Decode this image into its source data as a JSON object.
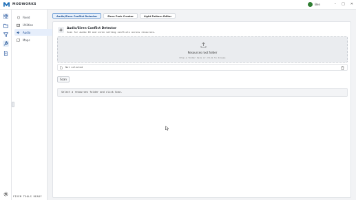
{
  "app": {
    "name": "MODWORKS",
    "logo_icon": "m-logo-icon"
  },
  "user": {
    "name": "Ben",
    "avatar_color": "#2e7d32"
  },
  "window_controls": [
    "–",
    "□",
    "✕"
  ],
  "rail": {
    "icons": [
      "grid-icon",
      "folder-icon",
      "funnel-icon",
      "wrench-icon",
      "document-icon"
    ],
    "active_index": 3,
    "settings_icon": "gear-icon"
  },
  "subnav": {
    "items": [
      {
        "label": "Fixed",
        "icon": "phone-icon"
      },
      {
        "label": "Utilities",
        "icon": "box-icon"
      },
      {
        "label": "Audio",
        "icon": "speaker-icon",
        "active": true
      },
      {
        "label": "Maps",
        "icon": "map-icon"
      }
    ]
  },
  "tabs": [
    {
      "label": "Audio/Siren Conflict Detector",
      "active": true
    },
    {
      "label": "Siren Pack Creator",
      "active": false
    },
    {
      "label": "Light Pattern Editor",
      "active": false
    }
  ],
  "detector": {
    "title": "Audio/Siren Conflict Detector",
    "subtitle": "Scan for audio ID and siren setting conflicts across resources."
  },
  "dropzone": {
    "title": "Resources root folder",
    "hint": "Drop a folder here or click to browse"
  },
  "file": {
    "name": "Not selected"
  },
  "scan_button": {
    "label": "Scan"
  },
  "output": {
    "text": "Select a resources folder and click Scan."
  },
  "statusbar": {
    "text": "FIVEM TOOLS READY"
  },
  "colors": {
    "accent": "#1d4f91",
    "active_bg": "#e7f0fb",
    "panel_bg": "#ffffff",
    "page_bg": "#f2f3f5"
  }
}
